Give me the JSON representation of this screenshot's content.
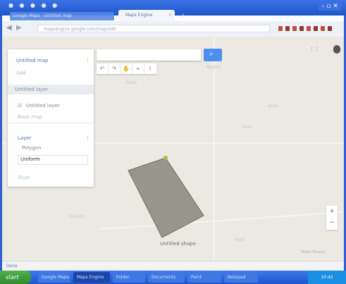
{
  "browser": {
    "tabs": [
      {
        "label": "Google Maps - Untitled map"
      },
      {
        "label": "Maps Engine",
        "active": true
      }
    ],
    "window_controls": "– ▫ ✕",
    "address": "mapsengine.google.com/map/edit",
    "address_extra": ""
  },
  "map": {
    "search_placeholder": "",
    "sidebar": {
      "map_title": "Untitled map",
      "map_subtitle": "Add",
      "add_layer": "Untitled layer",
      "layer_toggle": "Untitled layer",
      "base_map": "Base map",
      "layer2_title": "Layer",
      "layer2_item": "Polygon",
      "layer2_style": "Uniform",
      "footer": "Style"
    },
    "polygon_label": "Untitled shape",
    "faint_labels": [
      "Scale",
      "Region",
      "Area",
      "Town",
      "District",
      "Field"
    ],
    "footer_links": "Terms  Privacy"
  },
  "status": {
    "text": "Done"
  },
  "taskbar": {
    "start": "start",
    "tasks": [
      "Google Maps",
      "Maps Engine",
      "Folder",
      "Documents",
      "Paint",
      "Notepad"
    ],
    "tray_time": "10:42"
  },
  "colors": {
    "polygon_fill": "#8f8c84",
    "polygon_stroke": "#6f6c66",
    "vertex": "#9bc44a",
    "accent": "#4d8ff0"
  }
}
